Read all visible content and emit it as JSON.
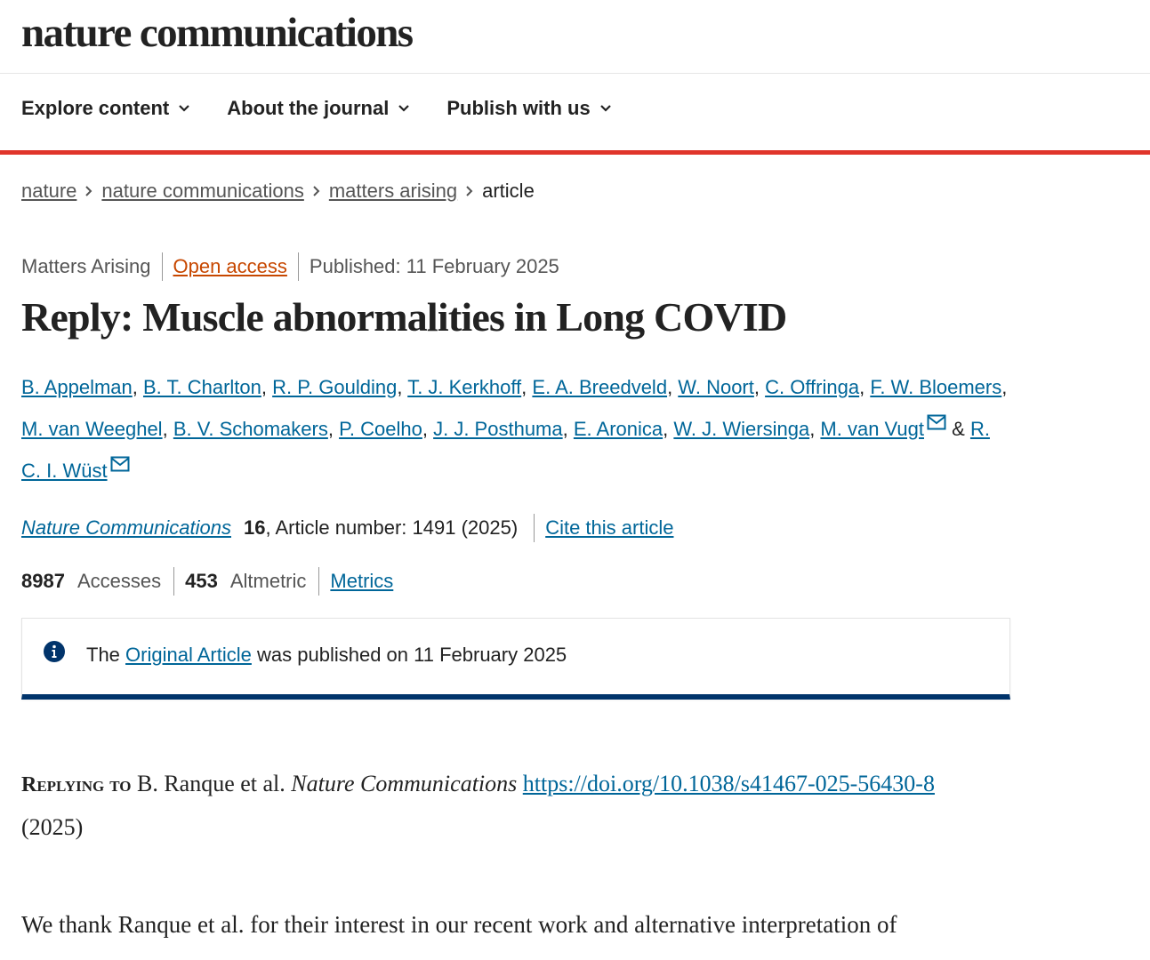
{
  "site": {
    "logo": "nature communications"
  },
  "nav": [
    {
      "label": "Explore content"
    },
    {
      "label": "About the journal"
    },
    {
      "label": "Publish with us"
    }
  ],
  "breadcrumb": {
    "items": [
      "nature",
      "nature communications",
      "matters arising"
    ],
    "current": "article"
  },
  "article": {
    "type": "Matters Arising",
    "access": "Open access",
    "published": "Published: 11 February 2025",
    "title": "Reply: Muscle abnormalities in Long COVID",
    "authors": [
      "B. Appelman",
      "B. T. Charlton",
      "R. P. Goulding",
      "T. J. Kerkhoff",
      "E. A. Breedveld",
      "W. Noort",
      "C. Offringa",
      "F. W. Bloemers",
      "M. van Weeghel",
      "B. V. Schomakers",
      "P. Coelho",
      "J. J. Posthuma",
      "E. Aronica",
      "W. J. Wiersinga",
      "M. van Vugt",
      "R. C. I. Wüst"
    ],
    "authors_joiner": "&",
    "journal": "Nature Communications",
    "volume": "16",
    "article_number": ", Article number: 1491 (2025)",
    "cite_label": "Cite this article",
    "accesses_value": "8987",
    "accesses_label": "Accesses",
    "altmetric_value": "453",
    "altmetric_label": "Altmetric",
    "metrics_label": "Metrics"
  },
  "notice": {
    "prefix": "The",
    "link": "Original Article",
    "suffix": "was published on 11 February 2025"
  },
  "replying": {
    "label": "Replying to",
    "authors": "B. Ranque et al.",
    "journal": "Nature Communications",
    "doi": "https://doi.org/10.1038/s41467-025-56430-8",
    "year": "(2025)"
  },
  "body": {
    "first_line": "We thank Ranque et al. for their interest in our recent work and alternative interpretation of"
  },
  "colors": {
    "accent_red": "#e0352b",
    "link_blue": "#069",
    "notice_blue": "#01346b",
    "open_access": "#c74700"
  }
}
